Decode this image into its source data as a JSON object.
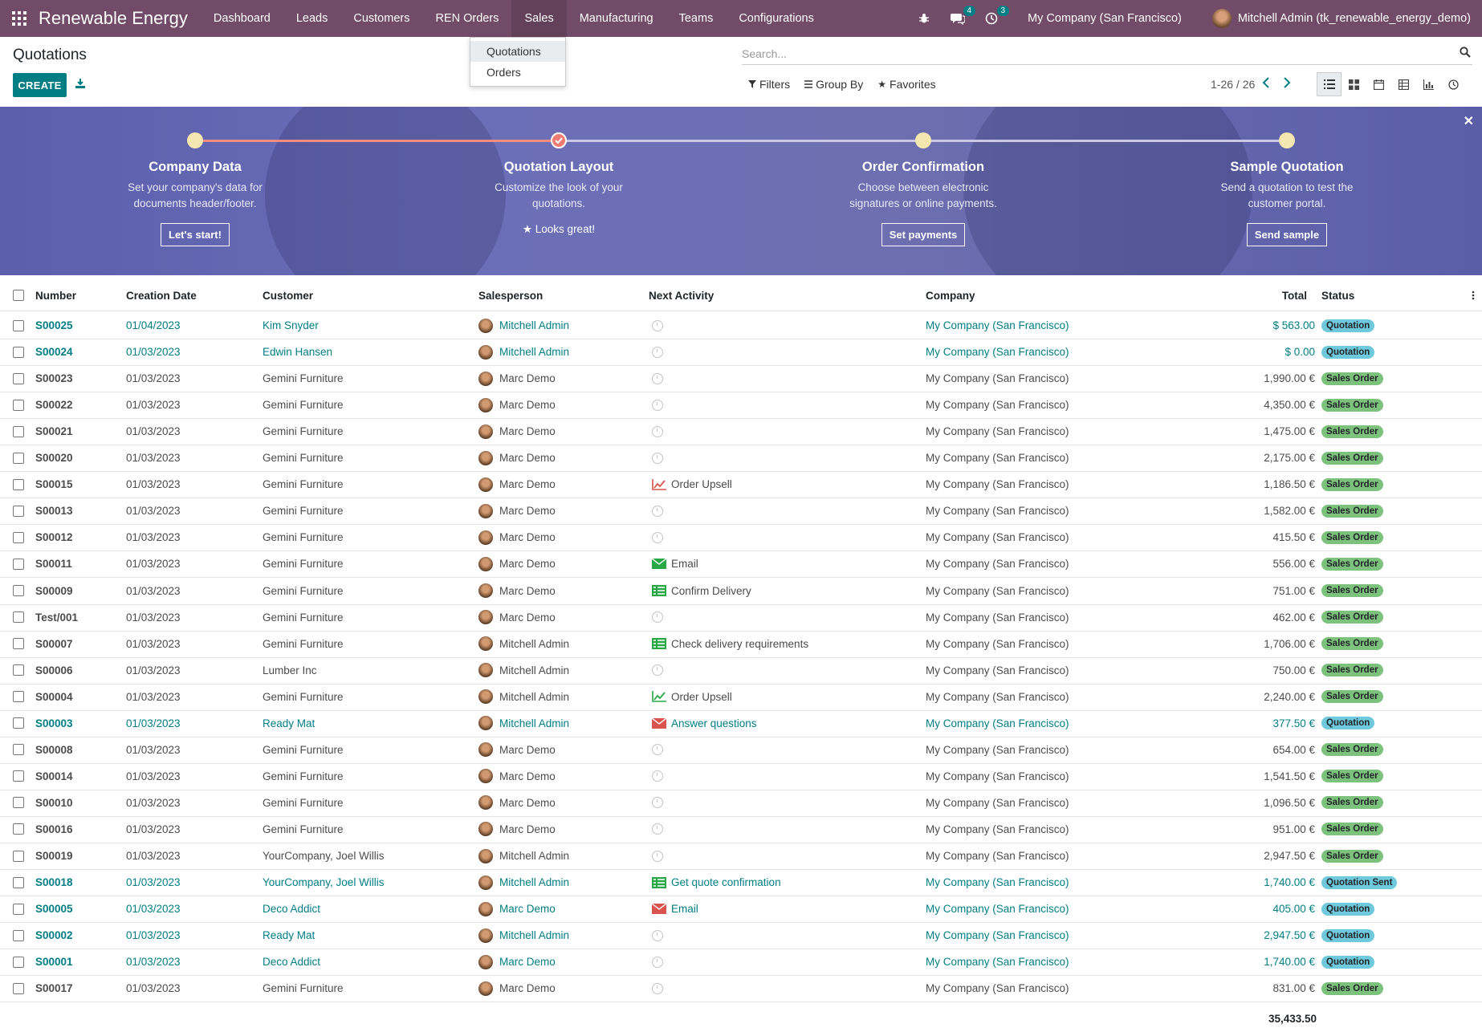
{
  "topbar": {
    "brand": "Renewable Energy",
    "menu": [
      "Dashboard",
      "Leads",
      "Customers",
      "REN Orders",
      "Sales",
      "Manufacturing",
      "Teams",
      "Configurations"
    ],
    "active_menu": "Sales",
    "chat_count": "4",
    "activity_count": "3",
    "company": "My Company (San Francisco)",
    "user": "Mitchell Admin (tk_renewable_energy_demo)"
  },
  "sales_dropdown": {
    "items": [
      "Quotations",
      "Orders"
    ]
  },
  "control": {
    "title": "Quotations",
    "create_label": "CREATE",
    "search_placeholder": "Search...",
    "filters_label": "Filters",
    "groupby_label": "Group By",
    "favorites_label": "Favorites",
    "pager": "1-26 / 26"
  },
  "banner": {
    "steps": [
      {
        "title": "Company Data",
        "desc1": "Set your company's data for",
        "desc2": "documents header/footer.",
        "button": "Let's start!"
      },
      {
        "title": "Quotation Layout",
        "desc1": "Customize the look of your",
        "desc2": "quotations.",
        "done": "Looks great!"
      },
      {
        "title": "Order Confirmation",
        "desc1": "Choose between electronic",
        "desc2": "signatures or online payments.",
        "button": "Set payments"
      },
      {
        "title": "Sample Quotation",
        "desc1": "Send a quotation to test the",
        "desc2": "customer portal.",
        "button": "Send sample"
      }
    ]
  },
  "table": {
    "headers": {
      "number": "Number",
      "date": "Creation Date",
      "customer": "Customer",
      "salesperson": "Salesperson",
      "activity": "Next Activity",
      "company": "Company",
      "total": "Total",
      "status": "Status"
    },
    "rows": [
      {
        "number": "S00025",
        "date": "01/04/2023",
        "customer": "Kim Snyder",
        "salesperson": "Mitchell Admin",
        "activity": "",
        "act_icon": "",
        "company": "My Company (San Francisco)",
        "total": "$ 563.00",
        "status": "Quotation",
        "hl": true
      },
      {
        "number": "S00024",
        "date": "01/03/2023",
        "customer": "Edwin Hansen",
        "salesperson": "Mitchell Admin",
        "activity": "",
        "act_icon": "",
        "company": "My Company (San Francisco)",
        "total": "$ 0.00",
        "status": "Quotation",
        "hl": true
      },
      {
        "number": "S00023",
        "date": "01/03/2023",
        "customer": "Gemini Furniture",
        "salesperson": "Marc Demo",
        "activity": "",
        "act_icon": "",
        "company": "My Company (San Francisco)",
        "total": "1,990.00 €",
        "status": "Sales Order",
        "hl": false
      },
      {
        "number": "S00022",
        "date": "01/03/2023",
        "customer": "Gemini Furniture",
        "salesperson": "Marc Demo",
        "activity": "",
        "act_icon": "",
        "company": "My Company (San Francisco)",
        "total": "4,350.00 €",
        "status": "Sales Order",
        "hl": false
      },
      {
        "number": "S00021",
        "date": "01/03/2023",
        "customer": "Gemini Furniture",
        "salesperson": "Marc Demo",
        "activity": "",
        "act_icon": "",
        "company": "My Company (San Francisco)",
        "total": "1,475.00 €",
        "status": "Sales Order",
        "hl": false
      },
      {
        "number": "S00020",
        "date": "01/03/2023",
        "customer": "Gemini Furniture",
        "salesperson": "Marc Demo",
        "activity": "",
        "act_icon": "",
        "company": "My Company (San Francisco)",
        "total": "2,175.00 €",
        "status": "Sales Order",
        "hl": false
      },
      {
        "number": "S00015",
        "date": "01/03/2023",
        "customer": "Gemini Furniture",
        "salesperson": "Marc Demo",
        "activity": "Order Upsell",
        "act_icon": "upsell-red",
        "company": "My Company (San Francisco)",
        "total": "1,186.50 €",
        "status": "Sales Order",
        "hl": false
      },
      {
        "number": "S00013",
        "date": "01/03/2023",
        "customer": "Gemini Furniture",
        "salesperson": "Marc Demo",
        "activity": "",
        "act_icon": "",
        "company": "My Company (San Francisco)",
        "total": "1,582.00 €",
        "status": "Sales Order",
        "hl": false
      },
      {
        "number": "S00012",
        "date": "01/03/2023",
        "customer": "Gemini Furniture",
        "salesperson": "Marc Demo",
        "activity": "",
        "act_icon": "",
        "company": "My Company (San Francisco)",
        "total": "415.50 €",
        "status": "Sales Order",
        "hl": false
      },
      {
        "number": "S00011",
        "date": "01/03/2023",
        "customer": "Gemini Furniture",
        "salesperson": "Marc Demo",
        "activity": "Email",
        "act_icon": "email-green",
        "company": "My Company (San Francisco)",
        "total": "556.00 €",
        "status": "Sales Order",
        "hl": false
      },
      {
        "number": "S00009",
        "date": "01/03/2023",
        "customer": "Gemini Furniture",
        "salesperson": "Marc Demo",
        "activity": "Confirm Delivery",
        "act_icon": "tasks-green",
        "company": "My Company (San Francisco)",
        "total": "751.00 €",
        "status": "Sales Order",
        "hl": false
      },
      {
        "number": "Test/001",
        "date": "01/03/2023",
        "customer": "Gemini Furniture",
        "salesperson": "Marc Demo",
        "activity": "",
        "act_icon": "",
        "company": "My Company (San Francisco)",
        "total": "462.00 €",
        "status": "Sales Order",
        "hl": false
      },
      {
        "number": "S00007",
        "date": "01/03/2023",
        "customer": "Gemini Furniture",
        "salesperson": "Mitchell Admin",
        "activity": "Check delivery requirements",
        "act_icon": "tasks-green",
        "company": "My Company (San Francisco)",
        "total": "1,706.00 €",
        "status": "Sales Order",
        "hl": false
      },
      {
        "number": "S00006",
        "date": "01/03/2023",
        "customer": "Lumber Inc",
        "salesperson": "Mitchell Admin",
        "activity": "",
        "act_icon": "",
        "company": "My Company (San Francisco)",
        "total": "750.00 €",
        "status": "Sales Order",
        "hl": false
      },
      {
        "number": "S00004",
        "date": "01/03/2023",
        "customer": "Gemini Furniture",
        "salesperson": "Mitchell Admin",
        "activity": "Order Upsell",
        "act_icon": "upsell-green",
        "company": "My Company (San Francisco)",
        "total": "2,240.00 €",
        "status": "Sales Order",
        "hl": false
      },
      {
        "number": "S00003",
        "date": "01/03/2023",
        "customer": "Ready Mat",
        "salesperson": "Mitchell Admin",
        "activity": "Answer questions",
        "act_icon": "email-red",
        "company": "My Company (San Francisco)",
        "total": "377.50 €",
        "status": "Quotation",
        "hl": true
      },
      {
        "number": "S00008",
        "date": "01/03/2023",
        "customer": "Gemini Furniture",
        "salesperson": "Marc Demo",
        "activity": "",
        "act_icon": "",
        "company": "My Company (San Francisco)",
        "total": "654.00 €",
        "status": "Sales Order",
        "hl": false
      },
      {
        "number": "S00014",
        "date": "01/03/2023",
        "customer": "Gemini Furniture",
        "salesperson": "Marc Demo",
        "activity": "",
        "act_icon": "",
        "company": "My Company (San Francisco)",
        "total": "1,541.50 €",
        "status": "Sales Order",
        "hl": false
      },
      {
        "number": "S00010",
        "date": "01/03/2023",
        "customer": "Gemini Furniture",
        "salesperson": "Marc Demo",
        "activity": "",
        "act_icon": "",
        "company": "My Company (San Francisco)",
        "total": "1,096.50 €",
        "status": "Sales Order",
        "hl": false
      },
      {
        "number": "S00016",
        "date": "01/03/2023",
        "customer": "Gemini Furniture",
        "salesperson": "Marc Demo",
        "activity": "",
        "act_icon": "",
        "company": "My Company (San Francisco)",
        "total": "951.00 €",
        "status": "Sales Order",
        "hl": false
      },
      {
        "number": "S00019",
        "date": "01/03/2023",
        "customer": "YourCompany, Joel Willis",
        "salesperson": "Mitchell Admin",
        "activity": "",
        "act_icon": "",
        "company": "My Company (San Francisco)",
        "total": "2,947.50 €",
        "status": "Sales Order",
        "hl": false
      },
      {
        "number": "S00018",
        "date": "01/03/2023",
        "customer": "YourCompany, Joel Willis",
        "salesperson": "Mitchell Admin",
        "activity": "Get quote confirmation",
        "act_icon": "tasks-green",
        "company": "My Company (San Francisco)",
        "total": "1,740.00 €",
        "status": "Quotation Sent",
        "hl": true
      },
      {
        "number": "S00005",
        "date": "01/03/2023",
        "customer": "Deco Addict",
        "salesperson": "Marc Demo",
        "activity": "Email",
        "act_icon": "email-red",
        "company": "My Company (San Francisco)",
        "total": "405.00 €",
        "status": "Quotation",
        "hl": true
      },
      {
        "number": "S00002",
        "date": "01/03/2023",
        "customer": "Ready Mat",
        "salesperson": "Mitchell Admin",
        "activity": "",
        "act_icon": "",
        "company": "My Company (San Francisco)",
        "total": "2,947.50 €",
        "status": "Quotation",
        "hl": true
      },
      {
        "number": "S00001",
        "date": "01/03/2023",
        "customer": "Deco Addict",
        "salesperson": "Marc Demo",
        "activity": "",
        "act_icon": "",
        "company": "My Company (San Francisco)",
        "total": "1,740.00 €",
        "status": "Quotation",
        "hl": true
      },
      {
        "number": "S00017",
        "date": "01/03/2023",
        "customer": "Gemini Furniture",
        "salesperson": "Marc Demo",
        "activity": "",
        "act_icon": "",
        "company": "My Company (San Francisco)",
        "total": "831.00 €",
        "status": "Sales Order",
        "hl": false
      }
    ],
    "sum_total": "35,433.50"
  },
  "colors": {
    "nav": "#714b67",
    "accent": "#017e84",
    "quotation_badge": "#6ec9dc",
    "sales_order_badge": "#7cc27d"
  }
}
